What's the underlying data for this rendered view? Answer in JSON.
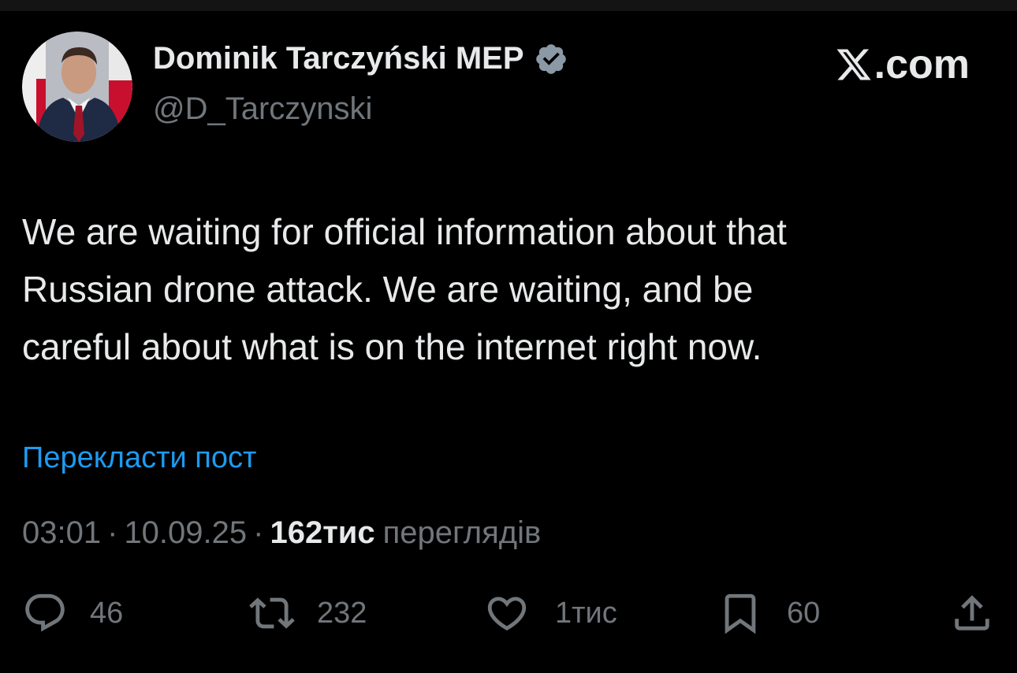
{
  "colors": {
    "background": "#000000",
    "text_primary": "#e7e9ea",
    "text_secondary": "#71767b",
    "link": "#1d9bf0",
    "verified_badge": "#8b98a5"
  },
  "site": {
    "brand_text": ".com",
    "logo_icon": "x-logo-icon"
  },
  "author": {
    "name": "Dominik Tarczyński MEP",
    "handle": "@D_Tarczynski",
    "avatar_icon": "avatar"
  },
  "tweet": {
    "text": "We are waiting for official information about that\nRussian drone attack. We are waiting, and be\ncareful about what is on the internet right now.",
    "translate_label": "Перекласти пост",
    "time": "03:01",
    "separator": "·",
    "date": "10.09.25",
    "views_count": "162тис",
    "views_label": "переглядів"
  },
  "actions": {
    "reply": {
      "icon": "reply-icon",
      "count": "46"
    },
    "repost": {
      "icon": "repost-icon",
      "count": "232"
    },
    "like": {
      "icon": "heart-icon",
      "count": "1тис"
    },
    "bookmark": {
      "icon": "bookmark-icon",
      "count": "60"
    },
    "share": {
      "icon": "share-icon"
    }
  }
}
